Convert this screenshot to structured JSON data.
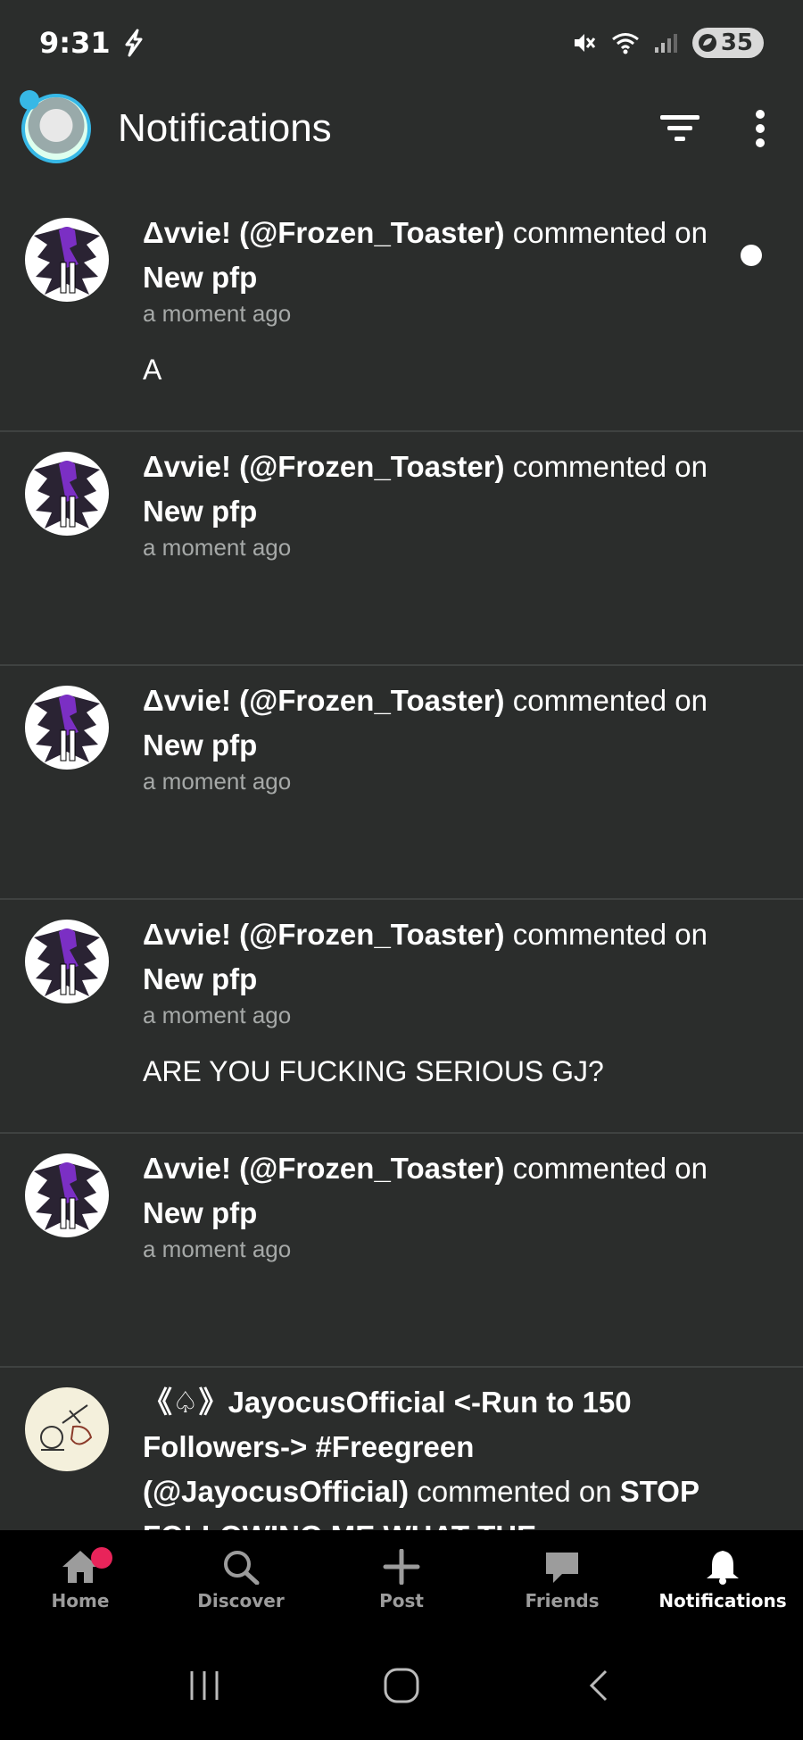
{
  "status_bar": {
    "time": "9:31",
    "battery": "35"
  },
  "header": {
    "title": "Notifications"
  },
  "notifications": [
    {
      "name": "Δvvie! (@Frozen_Toaster)",
      "action": " commented on ",
      "target": "New pfp",
      "time": "a moment ago",
      "body": "A",
      "unread": true
    },
    {
      "name": "Δvvie! (@Frozen_Toaster)",
      "action": " commented on ",
      "target": "New pfp",
      "time": "a moment ago",
      "body": "",
      "unread": false
    },
    {
      "name": "Δvvie! (@Frozen_Toaster)",
      "action": " commented on ",
      "target": "New pfp",
      "time": "a moment ago",
      "body": "",
      "unread": false
    },
    {
      "name": "Δvvie! (@Frozen_Toaster)",
      "action": " commented on ",
      "target": "New pfp",
      "time": "a moment ago",
      "body": "ARE YOU FUCKING SERIOUS GJ?",
      "unread": false
    },
    {
      "name": "Δvvie! (@Frozen_Toaster)",
      "action": " commented on ",
      "target": "New pfp",
      "time": "a moment ago",
      "body": "",
      "unread": false
    },
    {
      "name": "《♤》JayocusOfficial <-Run to 150 Followers-> #Freegreen (@JayocusOfficial)",
      "action": " commented on ",
      "target": "STOP FOLLOWING ME WHAT THE",
      "time": "",
      "body": "",
      "unread": false
    }
  ],
  "bottom_nav": [
    {
      "label": "Home",
      "icon": "home-icon"
    },
    {
      "label": "Discover",
      "icon": "search-icon"
    },
    {
      "label": "Post",
      "icon": "plus-icon"
    },
    {
      "label": "Friends",
      "icon": "chat-icon"
    },
    {
      "label": "Notifications",
      "icon": "bell-icon"
    }
  ],
  "colors": {
    "background": "#2b2d2c",
    "badge": "#e8245a",
    "avatar_ring": "#37b8e6"
  }
}
